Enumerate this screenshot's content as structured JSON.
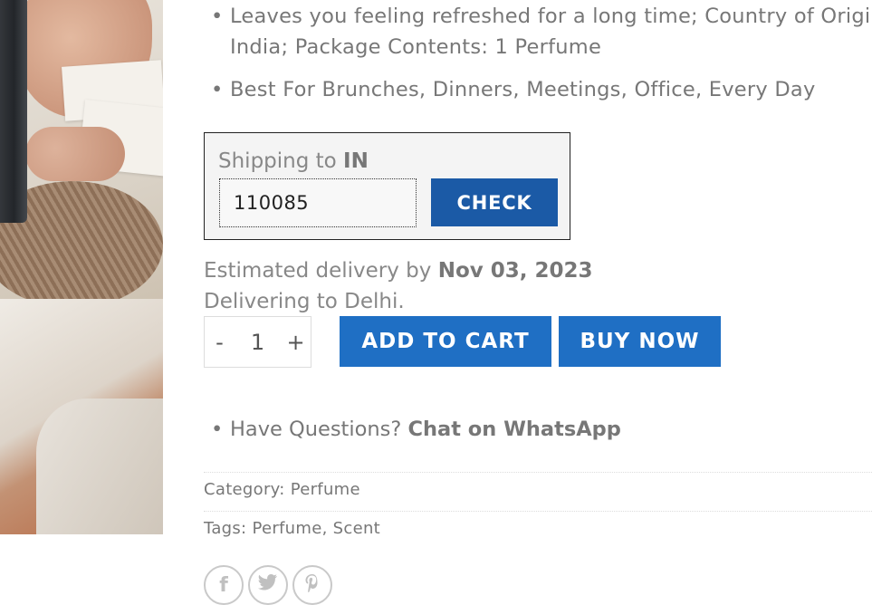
{
  "features": [
    "Leaves you feeling refreshed for a long time; Country of Origin: India; Package Contents: 1 Perfume",
    "Best For Brunches, Dinners, Meetings, Office, Every Day"
  ],
  "feature_lines": {
    "line1": "Leaves you feeling refreshed for a long time; Country of Origin:",
    "line2": "India; Package Contents: 1 Perfume",
    "line3": "Best For Brunches, Dinners, Meetings, Office, Every Day"
  },
  "shipping": {
    "prefix": "Shipping to",
    "country": "IN",
    "zip_value": "110085",
    "check_label": "CHECK"
  },
  "delivery": {
    "estimate_prefix": "Estimated delivery by",
    "date": "Nov 03, 2023",
    "delivering_to": "Delivering to Delhi."
  },
  "quantity": {
    "minus": "-",
    "value": "1",
    "plus": "+"
  },
  "buttons": {
    "add_to_cart": "ADD TO CART",
    "buy_now": "BUY NOW"
  },
  "questions": {
    "prefix": "Have Questions?",
    "link": "Chat on WhatsApp"
  },
  "meta": {
    "category_label": "Category:",
    "category": "Perfume",
    "tags_label": "Tags:",
    "tag1": "Perfume",
    "tag_sep": ", ",
    "tag2": "Scent"
  },
  "share_icons": [
    "facebook-icon",
    "twitter-icon",
    "pinterest-icon"
  ],
  "colors": {
    "check_button": "#1b5aa6",
    "cart_button": "#1f6fc4",
    "text": "#777777"
  }
}
